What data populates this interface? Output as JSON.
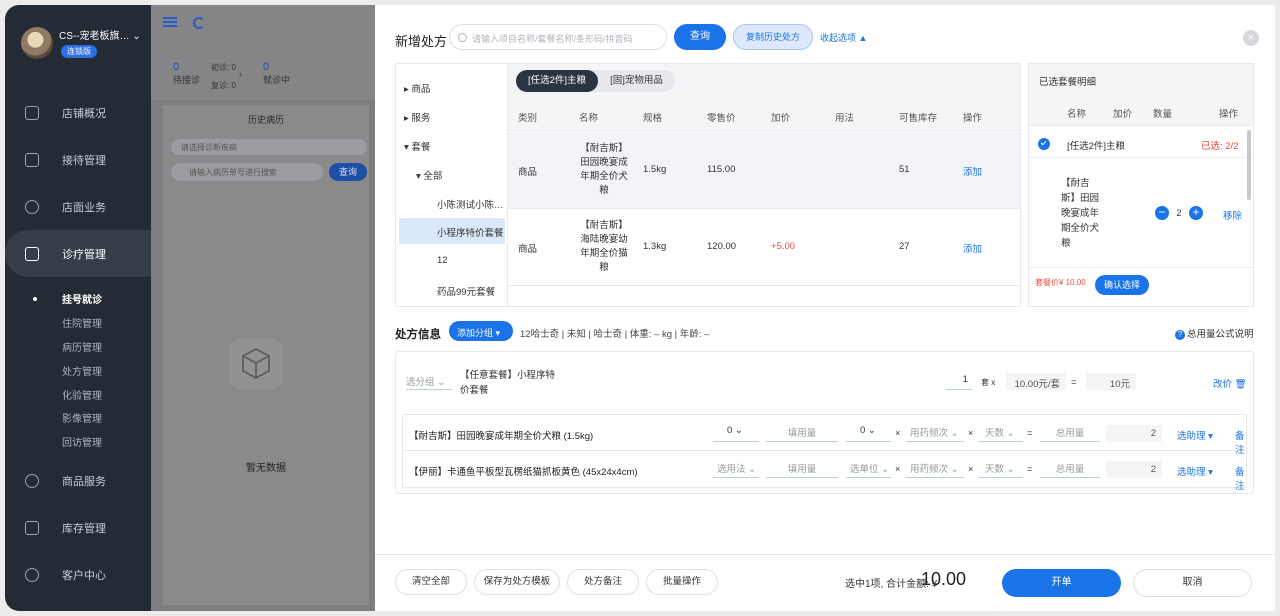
{
  "sidebar": {
    "store_name": "CS--宠老板旗…",
    "version": "连锁版",
    "nav": [
      {
        "label": "店铺概况"
      },
      {
        "label": "接待管理"
      },
      {
        "label": "店面业务"
      },
      {
        "label": "诊疗管理"
      },
      {
        "label": "商品服务"
      },
      {
        "label": "库存管理"
      },
      {
        "label": "客户中心"
      }
    ],
    "sub": [
      "挂号就诊",
      "住院管理",
      "病历管理",
      "处方管理",
      "化验管理",
      "影像管理",
      "回访管理"
    ]
  },
  "bg": {
    "wait_count": "0",
    "wait_label": "待接诊",
    "first_visit": "初诊: 0",
    "re_visit": "复诊: 0",
    "in_count": "0",
    "in_label": "就诊中",
    "history_title": "历史病历",
    "diag_placeholder": "请选择诊断疾病",
    "record_placeholder": "请输入病历单号进行搜索",
    "search_btn": "查询",
    "no_data": "暂无数据"
  },
  "drawer": {
    "title": "新增处方",
    "search_placeholder": "请输入项目名称/套餐名称/条形码/拼音码",
    "query_btn": "查询",
    "copy_btn": "复制历史处方",
    "collapse": "收起选项 ▲",
    "close": "×"
  },
  "tree": [
    "商品",
    "服务",
    "套餐",
    "全部",
    "小陈测试小陈…",
    "小程序特价套餐",
    "12",
    "药品99元套餐"
  ],
  "ptabs": [
    "[任选2件]主粮",
    "[固]宠物用品"
  ],
  "columns": [
    "类别",
    "名称",
    "规格",
    "零售价",
    "加价",
    "用法",
    "可售库存",
    "操作"
  ],
  "products": [
    {
      "cat": "商品",
      "name": "【耐吉斯】田园晚宴成年期全价犬粮",
      "spec": "1.5kg",
      "price": "115.00",
      "markup": "",
      "usage": "",
      "stock": "51",
      "op": "添加"
    },
    {
      "cat": "商品",
      "name": "【耐吉斯】海陆晚宴幼年期全价猫粮",
      "spec": "1.3kg",
      "price": "120.00",
      "markup": "+5.00",
      "usage": "",
      "stock": "27",
      "op": "添加"
    }
  ],
  "selected": {
    "title": "已选套餐明细",
    "cols": [
      "名称",
      "加价",
      "数量",
      "操作"
    ],
    "group": "[任选2件]主粮",
    "group_status": "已选: 2/2",
    "item_name": "【耐吉斯】田园晚宴成年期全价犬粮",
    "qty": "2",
    "remove": "移除",
    "pkg_price": "套餐价¥ 10.00",
    "confirm": "确认选择"
  },
  "rx": {
    "title": "处方信息",
    "add_group": "添加分组 ▾",
    "pet_info": "12哈士奇 | 未知 | 哈士奇 | 体重: – kg | 年龄: –",
    "help": "总用量公式说明",
    "group_select": "选分组",
    "pkg_name": "【任意套餐】小程序特价套餐",
    "pkg_qty": "1",
    "pkg_unit": "套 x",
    "pkg_unit_price": "10.00元/套",
    "eq": "=",
    "pkg_total": "10元",
    "edit_price": "改价",
    "drugs": [
      {
        "name": "【耐吉斯】田园晚宴成年期全价犬粮 (1.5kg)",
        "usage": "0",
        "dose": "填用量",
        "unit": "0",
        "freq": "用药频次",
        "days": "天数",
        "total_ph": "总用量",
        "total": "2",
        "assist": "选助理 ▾",
        "note": "备注"
      },
      {
        "name": "【伊丽】卡通鱼平板型瓦楞纸猫抓板黄色 (45x24x4cm)",
        "usage": "选用法",
        "dose": "填用量",
        "unit": "选单位",
        "freq": "用药频次",
        "days": "天数",
        "total_ph": "总用量",
        "total": "2",
        "assist": "选助理 ▾",
        "note": "备注"
      }
    ]
  },
  "footer": {
    "clear": "清空全部",
    "save_tpl": "保存为处方模板",
    "rx_note": "处方备注",
    "batch": "批量操作",
    "total_label": "选中1项, 合计金额: ¥",
    "amount": "10.00",
    "open": "开单",
    "cancel": "取消"
  },
  "colors": {
    "accent": "#1a73e8",
    "sidebar": "#242b35",
    "danger": "#f04a3d"
  }
}
